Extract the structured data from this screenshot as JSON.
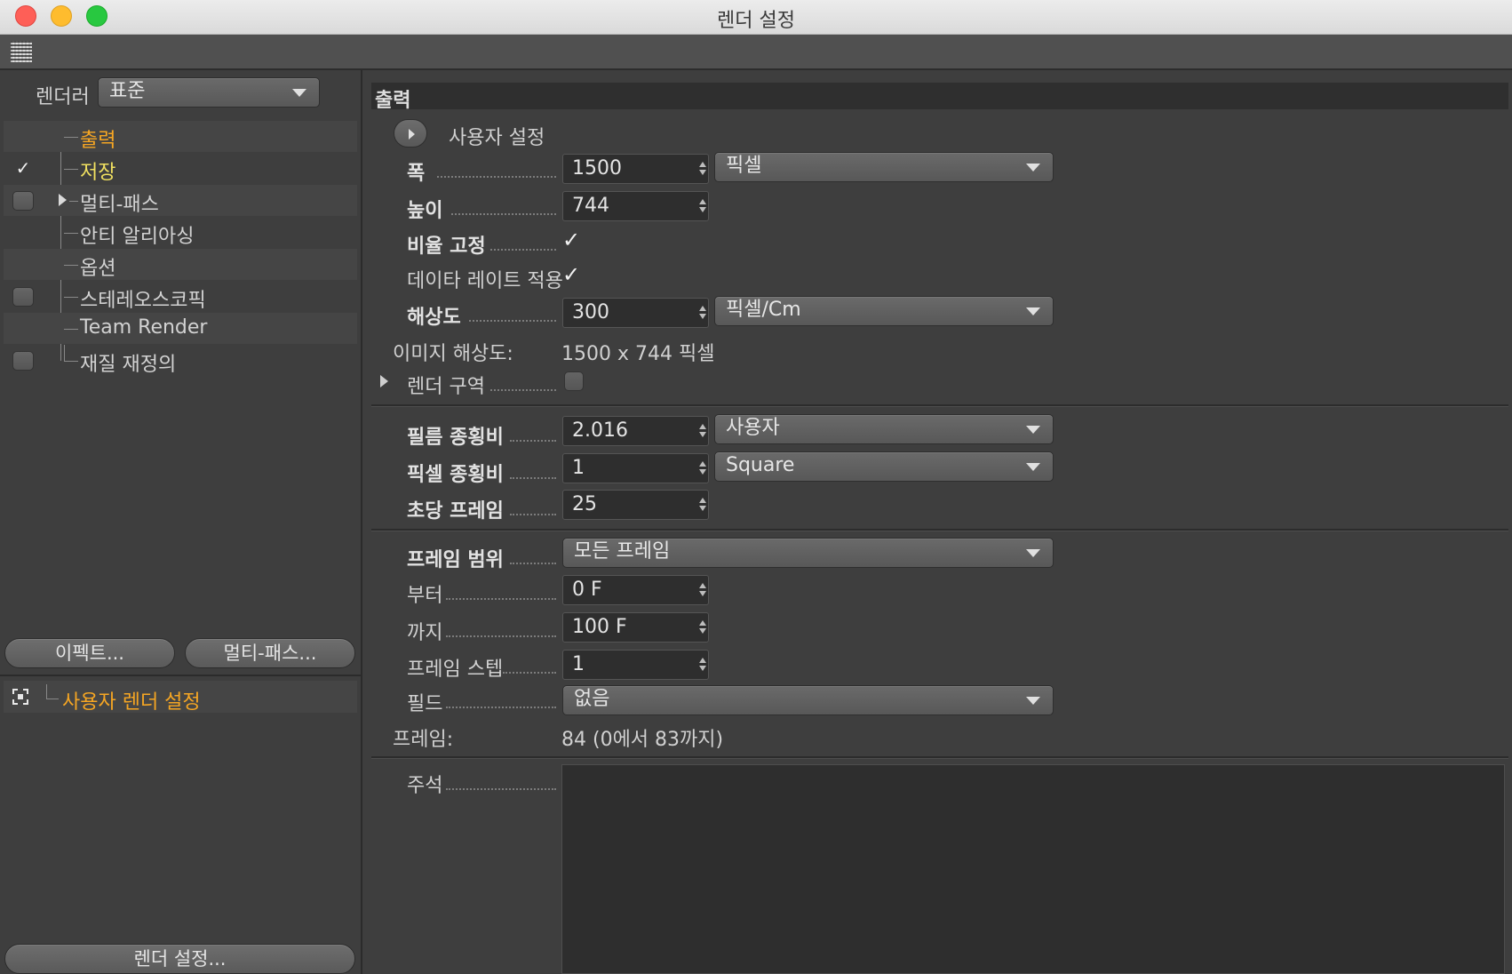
{
  "window": {
    "title": "렌더 설정"
  },
  "left": {
    "renderer_label": "렌더러",
    "renderer_value": "표준",
    "tree": [
      {
        "label": "출력",
        "checked": null
      },
      {
        "label": "저장",
        "checked": true
      },
      {
        "label": "멀티-패스",
        "checked": false
      },
      {
        "label": "안티 알리아싱",
        "checked": null
      },
      {
        "label": "옵션",
        "checked": null
      },
      {
        "label": "스테레오스코픽",
        "checked": false
      },
      {
        "label": "Team Render",
        "checked": null
      },
      {
        "label": "재질 재정의",
        "checked": false
      }
    ],
    "effects_button": "이펙트...",
    "multipass_button": "멀티-패스...",
    "custom_setting": "사용자 렌더 설정",
    "render_settings_button": "렌더 설정...",
    "check_glyph": "✓"
  },
  "right": {
    "section_title": "출력",
    "preset_label": "사용자 설정",
    "width": {
      "label": "폭",
      "value": "1500",
      "unit": "픽셀"
    },
    "height": {
      "label": "높이",
      "value": "744"
    },
    "lock_ratio": {
      "label": "비율 고정",
      "checked": true
    },
    "adapt_data_rate": {
      "label": "데이타 레이트 적용",
      "checked": true
    },
    "resolution": {
      "label": "해상도",
      "value": "300",
      "unit": "픽셀/Cm"
    },
    "image_resolution": {
      "label": "이미지 해상도:",
      "value": "1500 x 744 픽셀"
    },
    "render_region": {
      "label": "렌더 구역",
      "checked": false
    },
    "film_aspect": {
      "label": "필름 종횡비",
      "value": "2.016",
      "preset": "사용자"
    },
    "pixel_aspect": {
      "label": "픽셀 종횡비",
      "value": "1",
      "preset": "Square"
    },
    "frame_rate": {
      "label": "초당 프레임",
      "value": "25"
    },
    "frame_range": {
      "label": "프레임 범위",
      "value": "모든 프레임"
    },
    "from": {
      "label": "부터",
      "value": "0 F"
    },
    "to": {
      "label": "까지",
      "value": "100 F"
    },
    "frame_step": {
      "label": "프레임 스텝",
      "value": "1"
    },
    "field": {
      "label": "필드",
      "value": "없음"
    },
    "frames": {
      "label": "프레임:",
      "value": "84 (0에서 83까지)"
    },
    "notes": {
      "label": "주석",
      "value": ""
    }
  },
  "colors": {
    "accent_orange": "#f6a623",
    "accent_yellow": "#f0e060",
    "bg": "#3e3e3e",
    "field_bg": "#2e2e2e"
  }
}
